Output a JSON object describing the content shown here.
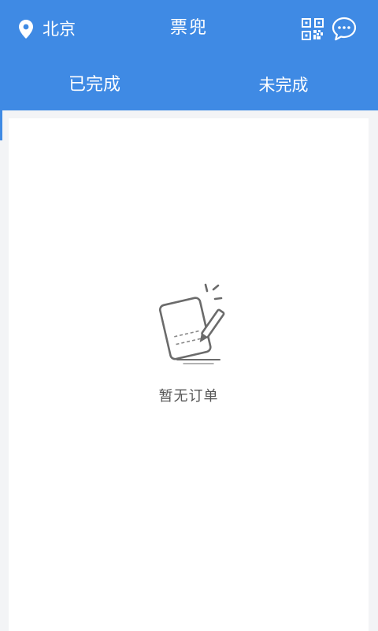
{
  "header": {
    "location": "北京",
    "title": "票兜",
    "icons": {
      "location": "location-pin-icon",
      "qr": "qr-code-icon",
      "message": "chat-bubble-icon"
    }
  },
  "tabs": [
    {
      "label": "已完成",
      "active": true
    },
    {
      "label": "未完成",
      "active": false
    }
  ],
  "empty_state": {
    "icon": "empty-orders-icon",
    "text": "暂无订单"
  },
  "colors": {
    "primary": "#3f8ae4",
    "background": "#f3f4f6",
    "card": "#ffffff",
    "text_muted": "#555555",
    "icon_gray": "#6b6b6b"
  }
}
